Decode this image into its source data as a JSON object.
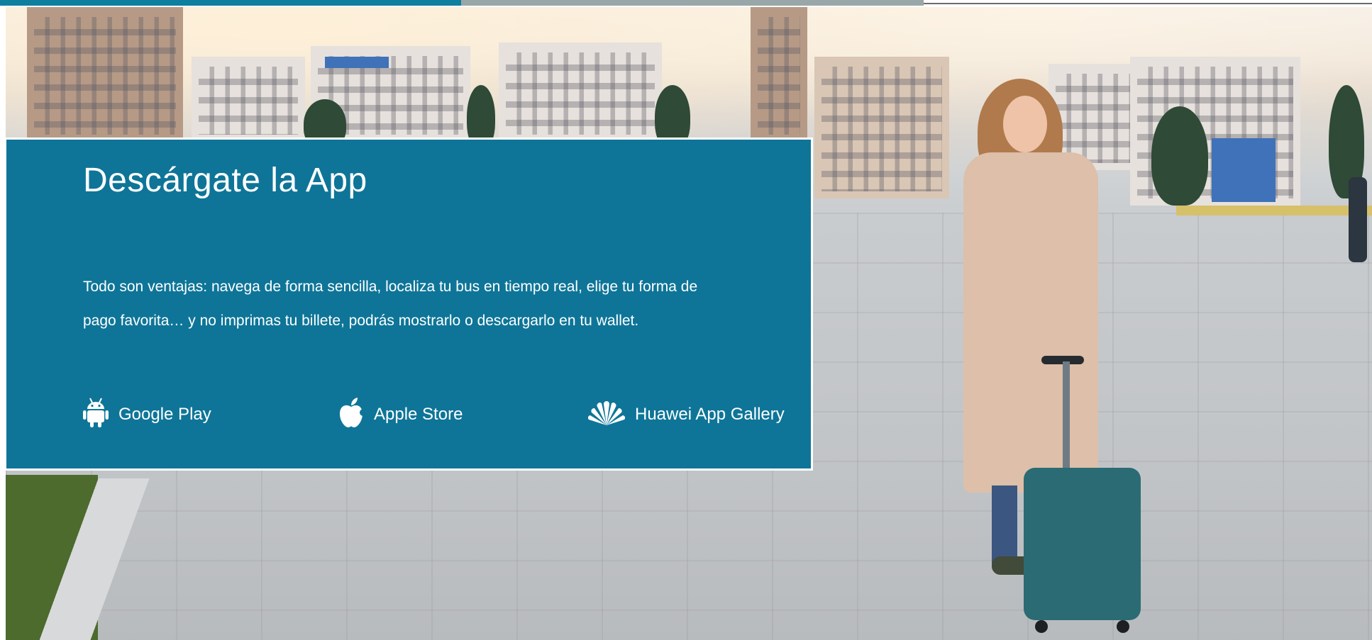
{
  "promo": {
    "title": "Descárgate la App",
    "body_line_1": "Todo son ventajas: navega de forma sencilla, localiza tu bus en tiempo real, elige tu forma de",
    "body_line_2": "pago favorita… y no imprimas tu billete, podrás mostrarlo o descargarlo en tu wallet.",
    "stores": [
      {
        "label": "Google Play",
        "icon": "android-icon"
      },
      {
        "label": "Apple Store",
        "icon": "apple-icon"
      },
      {
        "label": "Huawei App Gallery",
        "icon": "huawei-icon"
      }
    ]
  },
  "colors": {
    "card_background": "#0e7598",
    "top_strip_accent": "#0f7fa0",
    "text": "#ffffff"
  }
}
